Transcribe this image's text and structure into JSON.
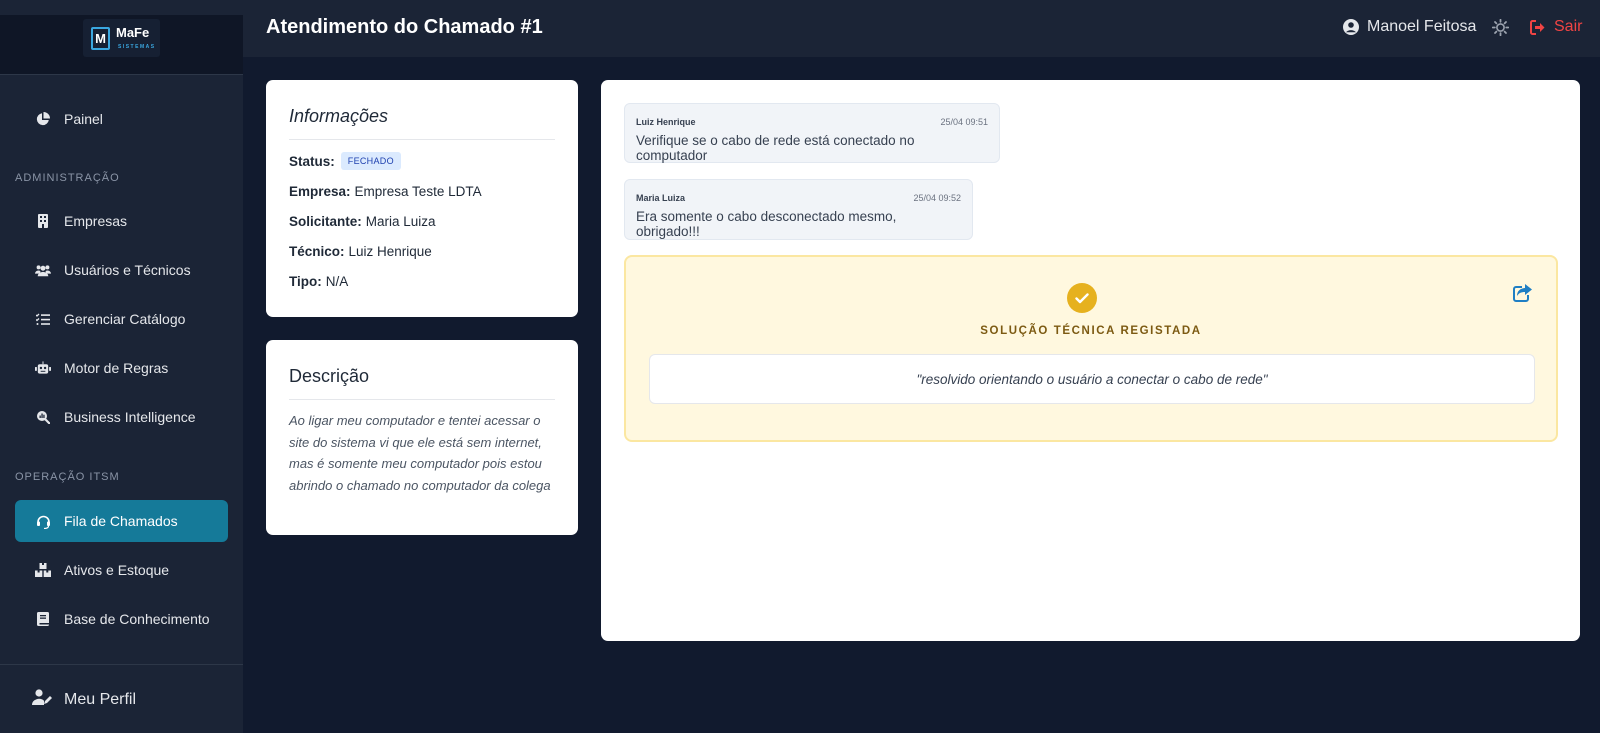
{
  "brand": {
    "name": "MaFe",
    "sub": "SISTEMAS",
    "letter": "M"
  },
  "sidebar": {
    "dashboard": "Painel",
    "section_admin": "ADMINISTRAÇÃO",
    "admin_items": [
      "Empresas",
      "Usuários e Técnicos",
      "Gerenciar Catálogo",
      "Motor de Regras",
      "Business Intelligence"
    ],
    "section_ops": "OPERAÇÃO ITSM",
    "ops_items": [
      "Fila de Chamados",
      "Ativos e Estoque",
      "Base de Conhecimento"
    ],
    "active_item": "Fila de Chamados",
    "profile": "Meu Perfil"
  },
  "header": {
    "title": "Atendimento do Chamado #1",
    "user": "Manoel Feitosa",
    "logout": "Sair"
  },
  "info": {
    "title": "Informações",
    "status_label": "Status:",
    "status_value": "FECHADO",
    "company_label": "Empresa:",
    "company_value": "Empresa Teste LDTA",
    "requester_label": "Solicitante:",
    "requester_value": "Maria Luiza",
    "tech_label": "Técnico:",
    "tech_value": "Luiz Henrique",
    "type_label": "Tipo:",
    "type_value": "N/A"
  },
  "description": {
    "title": "Descrição",
    "text": "Ao ligar meu computador e tentei acessar o site do sistema vi que ele está sem internet, mas é somente meu computador pois estou abrindo o chamado no computador da colega"
  },
  "messages": [
    {
      "author": "Luiz Henrique",
      "time": "25/04 09:51",
      "text": "Verifique se o cabo de rede está conectado no computador"
    },
    {
      "author": "Maria Luiza",
      "time": "25/04 09:52",
      "text": "Era somente o cabo desconectado mesmo, obrigado!!!"
    }
  ],
  "solution": {
    "title": "SOLUÇÃO TÉCNICA REGISTADA",
    "text": "\"resolvido orientando o usuário a conectar o cabo de rede\""
  },
  "colors": {
    "accent": "#157a99",
    "danger": "#ef4444",
    "gold": "#e6b11f"
  }
}
